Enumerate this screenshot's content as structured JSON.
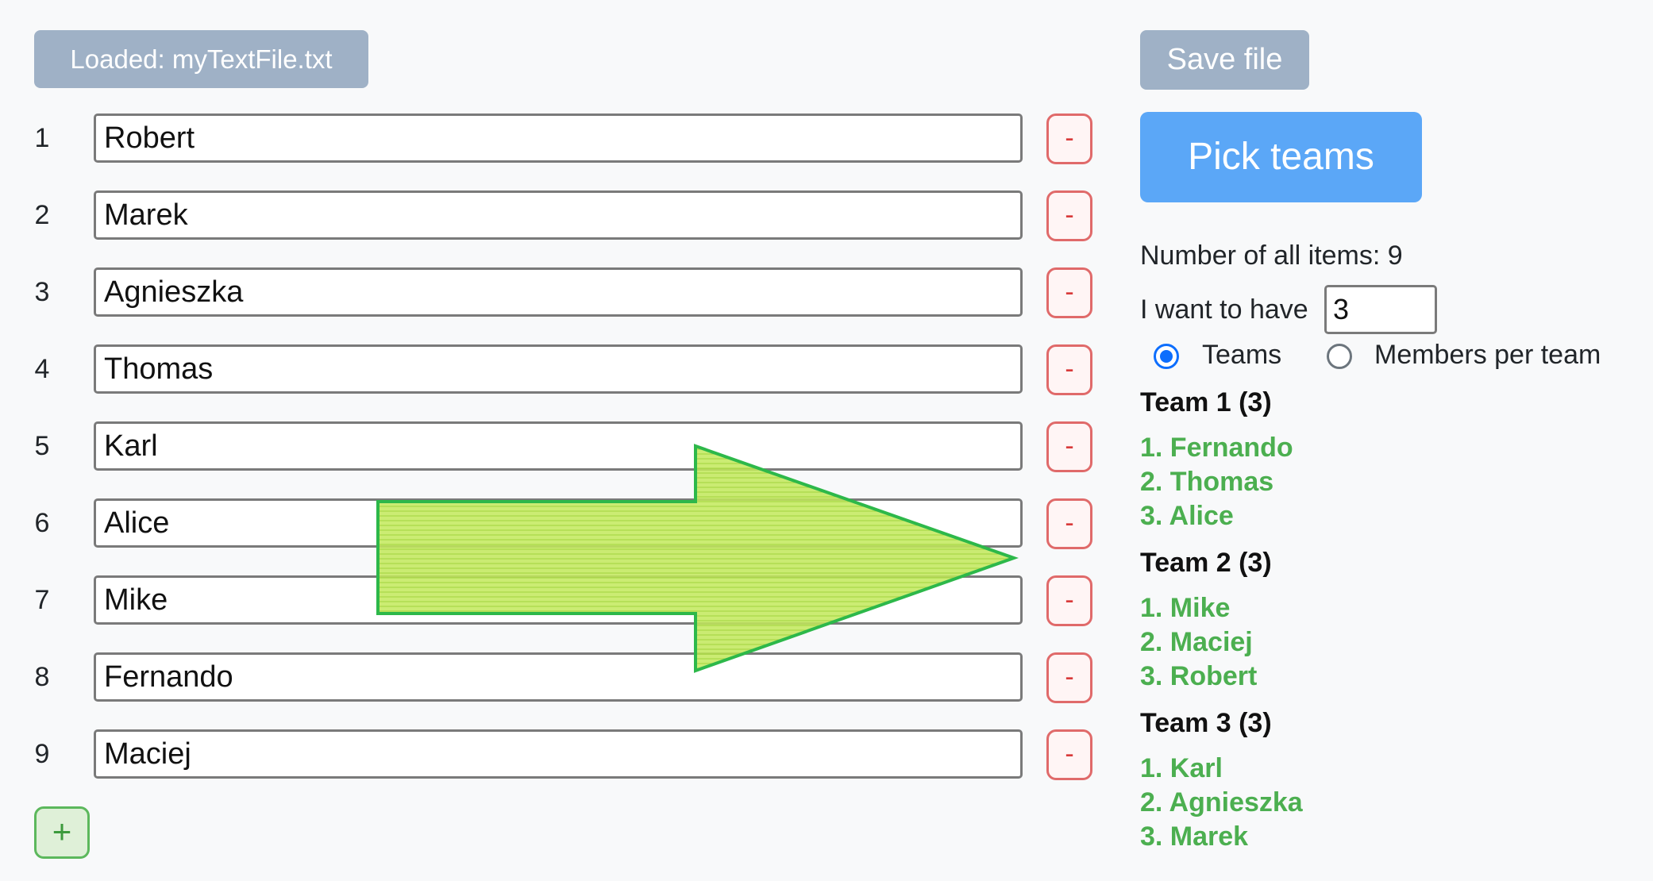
{
  "toolbar": {
    "loaded_label": "Loaded: myTextFile.txt",
    "save_label": "Save file",
    "pick_label": "Pick teams"
  },
  "items": [
    {
      "num": "1",
      "name": "Robert"
    },
    {
      "num": "2",
      "name": "Marek"
    },
    {
      "num": "3",
      "name": "Agnieszka"
    },
    {
      "num": "4",
      "name": "Thomas"
    },
    {
      "num": "5",
      "name": "Karl"
    },
    {
      "num": "6",
      "name": "Alice"
    },
    {
      "num": "7",
      "name": "Mike"
    },
    {
      "num": "8",
      "name": "Fernando"
    },
    {
      "num": "9",
      "name": "Maciej"
    }
  ],
  "remove_label": "-",
  "add_label": "+",
  "settings": {
    "count_text": "Number of all items: 9",
    "want_label": "I want to have",
    "want_value": "3",
    "option_teams": "Teams",
    "option_members": "Members per team",
    "selected_option": "Teams"
  },
  "teams": [
    {
      "title": "Team 1 (3)",
      "members": [
        "1. Fernando",
        "2. Thomas",
        "3. Alice"
      ]
    },
    {
      "title": "Team 2 (3)",
      "members": [
        "1. Mike",
        "2. Maciej",
        "3. Robert"
      ]
    },
    {
      "title": "Team 3 (3)",
      "members": [
        "1. Karl",
        "2. Agnieszka",
        "3. Marek"
      ]
    }
  ],
  "colors": {
    "loaded_button": "#9fb1c6",
    "pick_button": "#5ba7f7",
    "member_text": "#4caf50",
    "remove_border": "#e06a6a",
    "add_border": "#5cb85c",
    "arrow_fill": "#b5e04a",
    "arrow_stroke": "#2db84a"
  }
}
